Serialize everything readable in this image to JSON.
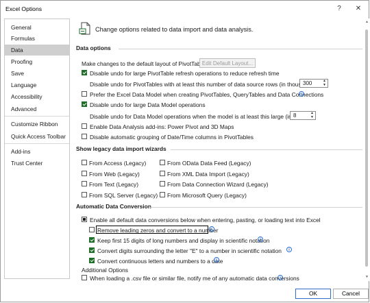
{
  "window": {
    "title": "Excel Options",
    "help_glyph": "?",
    "close_glyph": "✕"
  },
  "sidebar": {
    "items": [
      {
        "label": "General"
      },
      {
        "label": "Formulas"
      },
      {
        "label": "Data"
      },
      {
        "label": "Proofing"
      },
      {
        "label": "Save"
      },
      {
        "label": "Language"
      },
      {
        "label": "Accessibility"
      },
      {
        "label": "Advanced"
      },
      {
        "label": "Customize Ribbon"
      },
      {
        "label": "Quick Access Toolbar"
      },
      {
        "label": "Add-ins"
      },
      {
        "label": "Trust Center"
      }
    ],
    "selected_index": 2
  },
  "header": {
    "description": "Change options related to data import and data analysis."
  },
  "data_options": {
    "title": "Data options",
    "default_layout_label": "Make changes to the default layout of PivotTables:",
    "edit_layout_button": "Edit Default Layout...",
    "disable_undo_pivot": {
      "label": "Disable undo for large PivotTable refresh operations to reduce refresh time",
      "checked": true
    },
    "undo_rows_label": "Disable undo for PivotTables with at least this number of data source rows (in thousands):",
    "undo_rows_value": "300",
    "prefer_data_model": {
      "label": "Prefer the Excel Data Model when creating PivotTables, QueryTables and Data Connections",
      "checked": false
    },
    "disable_undo_model": {
      "label": "Disable undo for large Data Model operations",
      "checked": true
    },
    "undo_model_label": "Disable undo for Data Model operations when the model is at least this large (in MB):",
    "undo_model_value": "8",
    "enable_addins": {
      "label": "Enable Data Analysis add-ins: Power Pivot and 3D Maps",
      "checked": false
    },
    "disable_grouping": {
      "label": "Disable automatic grouping of Date/Time columns in PivotTables",
      "checked": false
    }
  },
  "legacy": {
    "title": "Show legacy data import wizards",
    "left": [
      {
        "label": "From Access (Legacy)",
        "checked": false
      },
      {
        "label": "From Web (Legacy)",
        "checked": false
      },
      {
        "label": "From Text (Legacy)",
        "checked": false
      },
      {
        "label": "From SQL Server (Legacy)",
        "checked": false
      }
    ],
    "right": [
      {
        "label": "From OData Data Feed (Legacy)",
        "checked": false
      },
      {
        "label": "From XML Data Import (Legacy)",
        "checked": false
      },
      {
        "label": "From Data Connection Wizard (Legacy)",
        "checked": false
      },
      {
        "label": "From Microsoft Query (Legacy)",
        "checked": false
      }
    ]
  },
  "auto_conversion": {
    "title": "Automatic Data Conversion",
    "enable_all": {
      "label": "Enable all default data conversions below when entering, pasting, or loading text into Excel",
      "checked": null
    },
    "remove_zeros": {
      "label": "Remove leading zeros and convert to a number",
      "checked": false
    },
    "keep_digits": {
      "label": "Keep first 15 digits of long numbers and display in scientific notation",
      "checked": true
    },
    "convert_e": {
      "label": "Convert digits surrounding the letter \"E\" to a number in scientific notation",
      "checked": true
    },
    "convert_letters": {
      "label": "Convert continuous letters and numbers to a date",
      "checked": true
    },
    "additional_title": "Additional Options",
    "notify_csv": {
      "label": "When loading a .csv file or similar file, notify me of any automatic data conversions",
      "checked": false
    }
  },
  "footer": {
    "ok": "OK",
    "cancel": "Cancel"
  },
  "colors": {
    "accent": "#1f6e2a",
    "info": "#2b6fd6",
    "selected_nav": "#cfcfcf"
  },
  "icons": {
    "header": "document-data-icon",
    "info": "info-icon"
  }
}
